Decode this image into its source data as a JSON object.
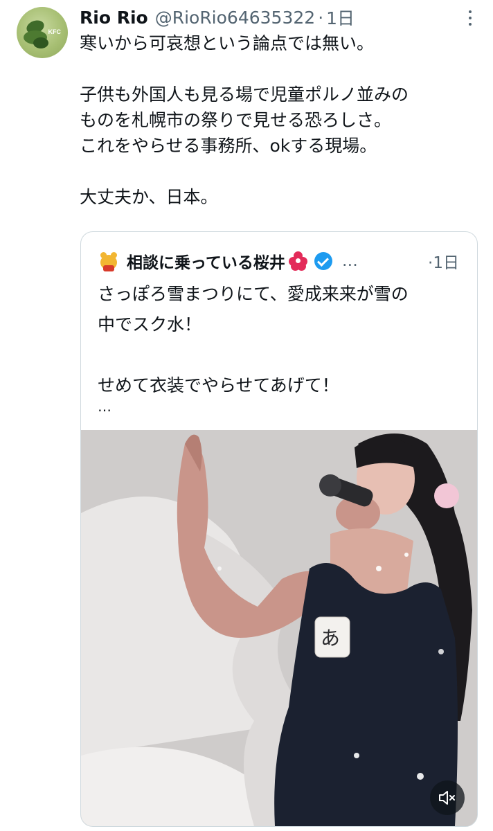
{
  "tweet": {
    "author_name": "Rio Rio",
    "handle": "@RioRio64635322",
    "separator": "·",
    "time": "1日",
    "avatar_label": "KFC",
    "text": "寒いから可哀想という論点では無い。\n\n子供も外国人も見る場で児童ポルノ並みの\nものを札幌市の祭りで見せる恐ろしさ。\nこれをやらせる事務所、okする現場。\n\n大丈夫か、日本。"
  },
  "quote": {
    "author_name": "相談に乗っている桜井",
    "ellipsis": "…",
    "time": "·1日",
    "text": "さっぽろ雪まつりにて、愛成来来が雪の\n中でスク水！\n\nせめて衣装でやらせてあげて！",
    "more": "…",
    "nametag_text": "あ",
    "media_alt": "video of performer singing on snow stage"
  },
  "icons": {
    "more": "more-vertical-icon",
    "verified": "verified-badge-icon",
    "flower": "hibiscus-emoji-icon",
    "mute": "volume-muted-icon"
  },
  "colors": {
    "text": "#0f1419",
    "secondary": "#536471",
    "verified": "#1d9bf0",
    "border": "#cfd9de"
  }
}
